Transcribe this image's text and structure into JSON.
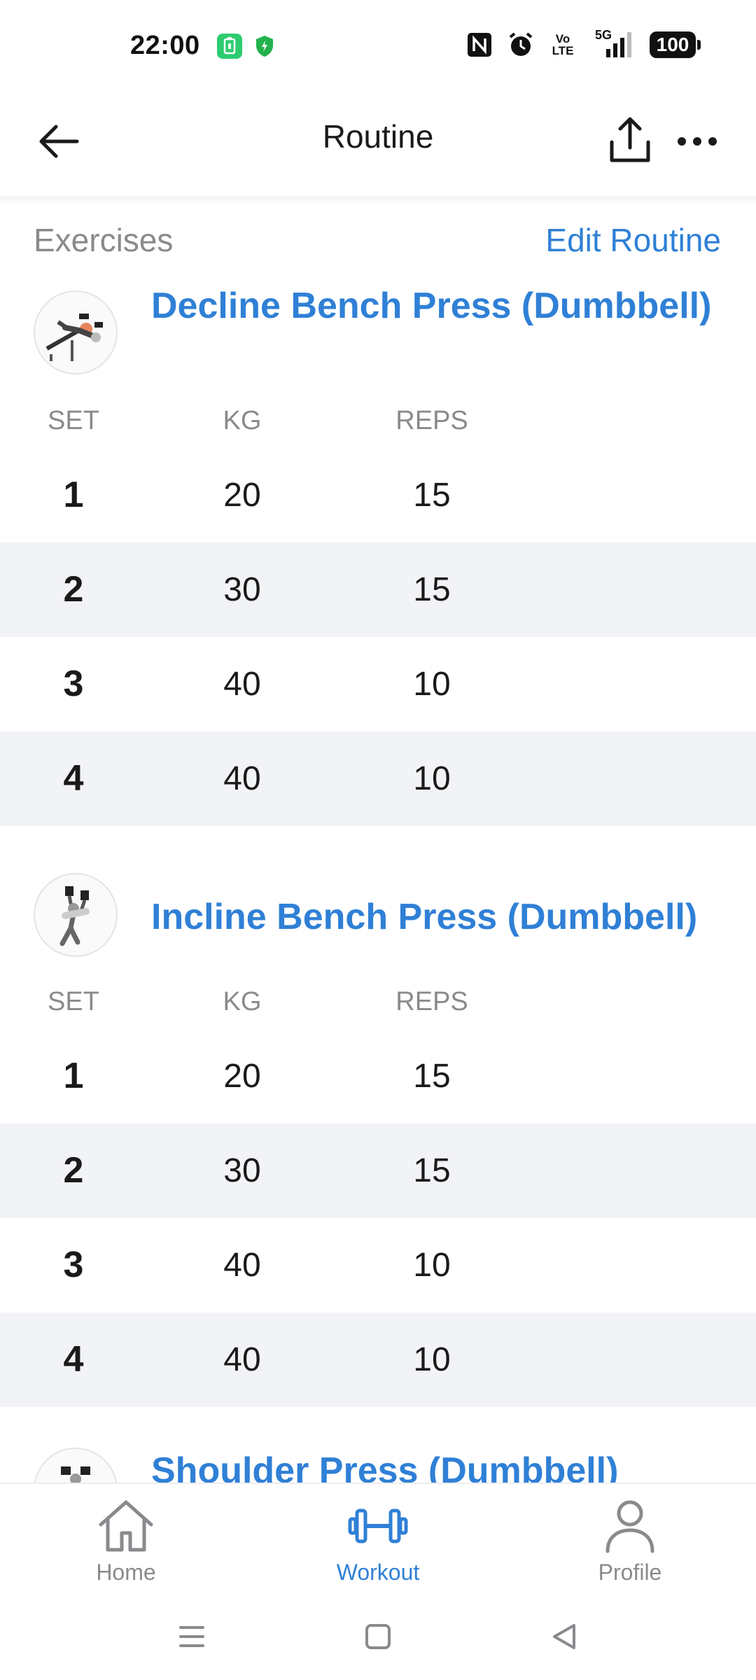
{
  "status_bar": {
    "time": "22:00",
    "network": "5G",
    "volte": "Vo LTE",
    "battery": "100"
  },
  "header": {
    "title": "Routine"
  },
  "section": {
    "label": "Exercises",
    "edit_label": "Edit Routine"
  },
  "columns": {
    "set": "SET",
    "kg": "KG",
    "reps": "REPS"
  },
  "exercises": [
    {
      "title": "Decline Bench Press (Dumbbell)",
      "sets": [
        {
          "set": "1",
          "kg": "20",
          "reps": "15"
        },
        {
          "set": "2",
          "kg": "30",
          "reps": "15"
        },
        {
          "set": "3",
          "kg": "40",
          "reps": "10"
        },
        {
          "set": "4",
          "kg": "40",
          "reps": "10"
        }
      ]
    },
    {
      "title": "Incline Bench Press (Dumbbell)",
      "sets": [
        {
          "set": "1",
          "kg": "20",
          "reps": "15"
        },
        {
          "set": "2",
          "kg": "30",
          "reps": "15"
        },
        {
          "set": "3",
          "kg": "40",
          "reps": "10"
        },
        {
          "set": "4",
          "kg": "40",
          "reps": "10"
        }
      ]
    },
    {
      "title": "Shoulder Press (Dumbbell)"
    }
  ],
  "bottom_nav": {
    "home": "Home",
    "workout": "Workout",
    "profile": "Profile",
    "active": "workout"
  },
  "colors": {
    "accent": "#2f80d6",
    "muted": "#8a8a8e",
    "row_shade": "#f2f3f6"
  }
}
